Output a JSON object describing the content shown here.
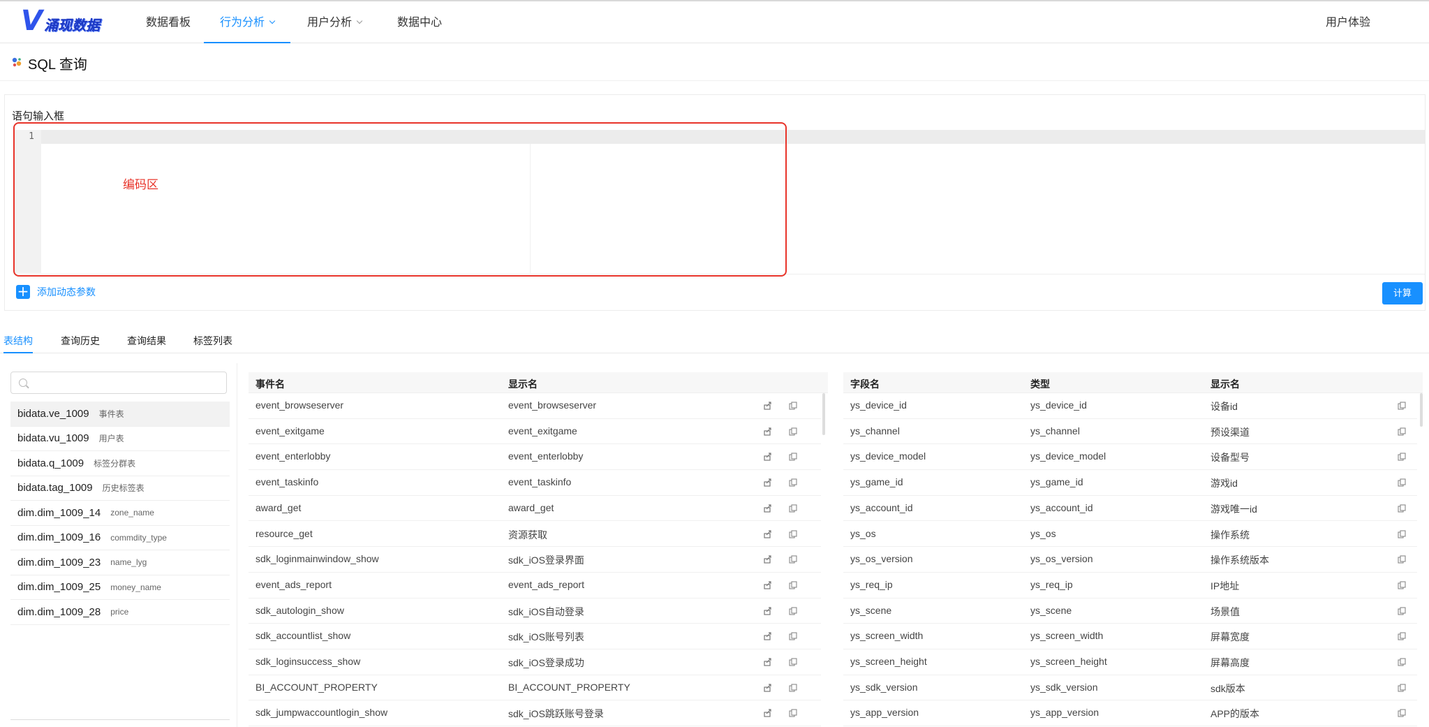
{
  "brand": {
    "mark": "V",
    "name": "涌现数据"
  },
  "nav": {
    "items": [
      {
        "label": "数据看板"
      },
      {
        "label": "行为分析"
      },
      {
        "label": "用户分析"
      },
      {
        "label": "数据中心"
      }
    ],
    "right_label": "用户体验"
  },
  "page": {
    "title": "SQL 查询"
  },
  "editor": {
    "label": "语句输入框",
    "line_number": "1",
    "annotation": "编码区",
    "add_param_label": "添加动态参数",
    "calc_button": "计算"
  },
  "tabs": [
    {
      "label": "表结构"
    },
    {
      "label": "查询历史"
    },
    {
      "label": "查询结果"
    },
    {
      "label": "标签列表"
    }
  ],
  "search": {
    "placeholder": "",
    "value": ""
  },
  "table_list": [
    {
      "name": "bidata.ve_1009",
      "desc": "事件表"
    },
    {
      "name": "bidata.vu_1009",
      "desc": "用户表"
    },
    {
      "name": "bidata.q_1009",
      "desc": "标签分群表"
    },
    {
      "name": "bidata.tag_1009",
      "desc": "历史标签表"
    },
    {
      "name": "dim.dim_1009_14",
      "desc": "zone_name"
    },
    {
      "name": "dim.dim_1009_16",
      "desc": "commdity_type"
    },
    {
      "name": "dim.dim_1009_23",
      "desc": "name_lyg"
    },
    {
      "name": "dim.dim_1009_25",
      "desc": "money_name"
    },
    {
      "name": "dim.dim_1009_28",
      "desc": "price"
    }
  ],
  "events_grid": {
    "headers": {
      "event": "事件名",
      "display": "显示名"
    },
    "rows": [
      {
        "event": "event_browseserver",
        "display": "event_browseserver"
      },
      {
        "event": "event_exitgame",
        "display": "event_exitgame"
      },
      {
        "event": "event_enterlobby",
        "display": "event_enterlobby"
      },
      {
        "event": "event_taskinfo",
        "display": "event_taskinfo"
      },
      {
        "event": "award_get",
        "display": "award_get"
      },
      {
        "event": "resource_get",
        "display": "资源获取"
      },
      {
        "event": "sdk_loginmainwindow_show",
        "display": "sdk_iOS登录界面"
      },
      {
        "event": "event_ads_report",
        "display": "event_ads_report"
      },
      {
        "event": "sdk_autologin_show",
        "display": "sdk_iOS自动登录"
      },
      {
        "event": "sdk_accountlist_show",
        "display": "sdk_iOS账号列表"
      },
      {
        "event": "sdk_loginsuccess_show",
        "display": "sdk_iOS登录成功"
      },
      {
        "event": "BI_ACCOUNT_PROPERTY",
        "display": "BI_ACCOUNT_PROPERTY"
      },
      {
        "event": "sdk_jumpwaccountlogin_show",
        "display": "sdk_iOS跳跃账号登录"
      }
    ]
  },
  "fields_grid": {
    "headers": {
      "field": "字段名",
      "type": "类型",
      "display": "显示名"
    },
    "rows": [
      {
        "field": "ys_device_id",
        "type": "ys_device_id",
        "display": "设备id"
      },
      {
        "field": "ys_channel",
        "type": "ys_channel",
        "display": "预设渠道"
      },
      {
        "field": "ys_device_model",
        "type": "ys_device_model",
        "display": "设备型号"
      },
      {
        "field": "ys_game_id",
        "type": "ys_game_id",
        "display": "游戏id"
      },
      {
        "field": "ys_account_id",
        "type": "ys_account_id",
        "display": "游戏唯一id"
      },
      {
        "field": "ys_os",
        "type": "ys_os",
        "display": "操作系统"
      },
      {
        "field": "ys_os_version",
        "type": "ys_os_version",
        "display": "操作系统版本"
      },
      {
        "field": "ys_req_ip",
        "type": "ys_req_ip",
        "display": "IP地址"
      },
      {
        "field": "ys_scene",
        "type": "ys_scene",
        "display": "场景值"
      },
      {
        "field": "ys_screen_width",
        "type": "ys_screen_width",
        "display": "屏幕宽度"
      },
      {
        "field": "ys_screen_height",
        "type": "ys_screen_height",
        "display": "屏幕高度"
      },
      {
        "field": "ys_sdk_version",
        "type": "ys_sdk_version",
        "display": "sdk版本"
      },
      {
        "field": "ys_app_version",
        "type": "ys_app_version",
        "display": "APP的版本"
      }
    ]
  },
  "icons": {
    "row_export": "export-icon",
    "row_copy": "copy-icon"
  },
  "colors": {
    "accent": "#1890ff",
    "annotation": "#e8342a"
  }
}
